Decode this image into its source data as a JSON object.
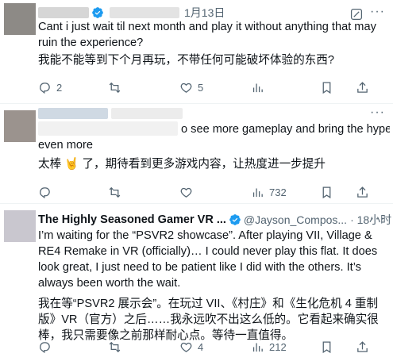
{
  "tweets": [
    {
      "date": "1月13日",
      "text_en": "Cant i just wait til next month and play it without anything that may ruin the experience?",
      "text_zh": "我能不能等到下个月再玩，不带任何可能破坏体验的东西?",
      "replies": "2",
      "reposts": "",
      "likes": "5",
      "views": ""
    },
    {
      "text_en": "o see more gameplay and bring the hype up even more",
      "text_zh": "太棒 🤘 了，期待看到更多游戏内容，让热度进一步提升",
      "replies": "",
      "reposts": "",
      "likes": "",
      "views": "732"
    },
    {
      "name": "The Highly Seasoned Gamer VR ...",
      "handle": "@Jayson_Compos...",
      "time": "· 18小时",
      "text_en": "I’m waiting for the “PSVR2 showcase”. After playing VII, Village & RE4 Remake in VR (officially)… I could never play this flat. It does look great, I just need to be patient like I did with the others. It’s always been worth the wait.",
      "text_zh": "我在等“PSVR2 展示会”。在玩过 VII、《村庄》和《生化危机 4 重制版》VR（官方）之后……我永远吹不出这么低的。它看起来确实很棒，我只需要像之前那样耐心点。等待一直值得。",
      "replies": "",
      "reposts": "",
      "likes": "4",
      "views": "212"
    }
  ],
  "icons": {
    "reply": "reply-icon",
    "repost": "repost-icon",
    "like": "heart-icon",
    "views": "views-icon",
    "grok": "grok-icon",
    "verified": "verified-badge-icon",
    "more": "more-icon"
  },
  "colors": {
    "verified": "#1d9bf0",
    "text": "#0f1419",
    "secondary": "#536471",
    "divider": "#eff3f4"
  }
}
